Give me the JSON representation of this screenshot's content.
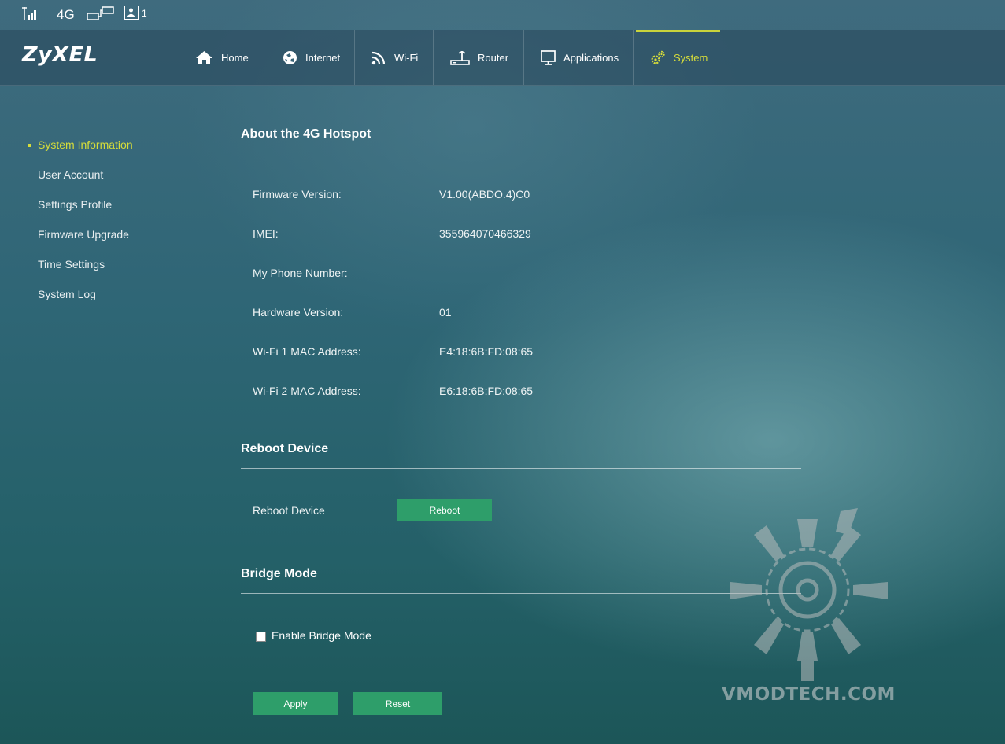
{
  "statusbar": {
    "network_type": "4G",
    "connected_users": "1"
  },
  "brand": {
    "logo": "ZyXEL"
  },
  "nav": {
    "items": [
      {
        "label": "Home",
        "icon": "home-icon"
      },
      {
        "label": "Internet",
        "icon": "globe-icon"
      },
      {
        "label": "Wi-Fi",
        "icon": "wifi-icon"
      },
      {
        "label": "Router",
        "icon": "router-icon"
      },
      {
        "label": "Applications",
        "icon": "monitor-icon"
      },
      {
        "label": "System",
        "icon": "gear-icon"
      }
    ],
    "active": "System"
  },
  "sidebar": {
    "items": [
      {
        "label": "System Information"
      },
      {
        "label": "User Account"
      },
      {
        "label": "Settings Profile"
      },
      {
        "label": "Firmware Upgrade"
      },
      {
        "label": "Time Settings"
      },
      {
        "label": "System Log"
      }
    ],
    "active": "System Information"
  },
  "about": {
    "title": "About the 4G Hotspot",
    "rows": [
      {
        "label": "Firmware Version:",
        "value": "V1.00(ABDO.4)C0"
      },
      {
        "label": "IMEI:",
        "value": "355964070466329"
      },
      {
        "label": "My Phone Number:",
        "value": ""
      },
      {
        "label": "Hardware Version:",
        "value": "01"
      },
      {
        "label": "Wi-Fi 1 MAC Address:",
        "value": "E4:18:6B:FD:08:65"
      },
      {
        "label": "Wi-Fi 2 MAC Address:",
        "value": "E6:18:6B:FD:08:65"
      }
    ]
  },
  "reboot": {
    "title": "Reboot Device",
    "label": "Reboot Device",
    "button": "Reboot"
  },
  "bridge": {
    "title": "Bridge Mode",
    "checkbox_label": "Enable Bridge Mode",
    "checked": false
  },
  "actions": {
    "apply": "Apply",
    "reset": "Reset"
  },
  "watermark": {
    "text": "VMODTECH.COM"
  },
  "colors": {
    "accent": "#d6dc3a",
    "button": "#2e9e6a"
  }
}
